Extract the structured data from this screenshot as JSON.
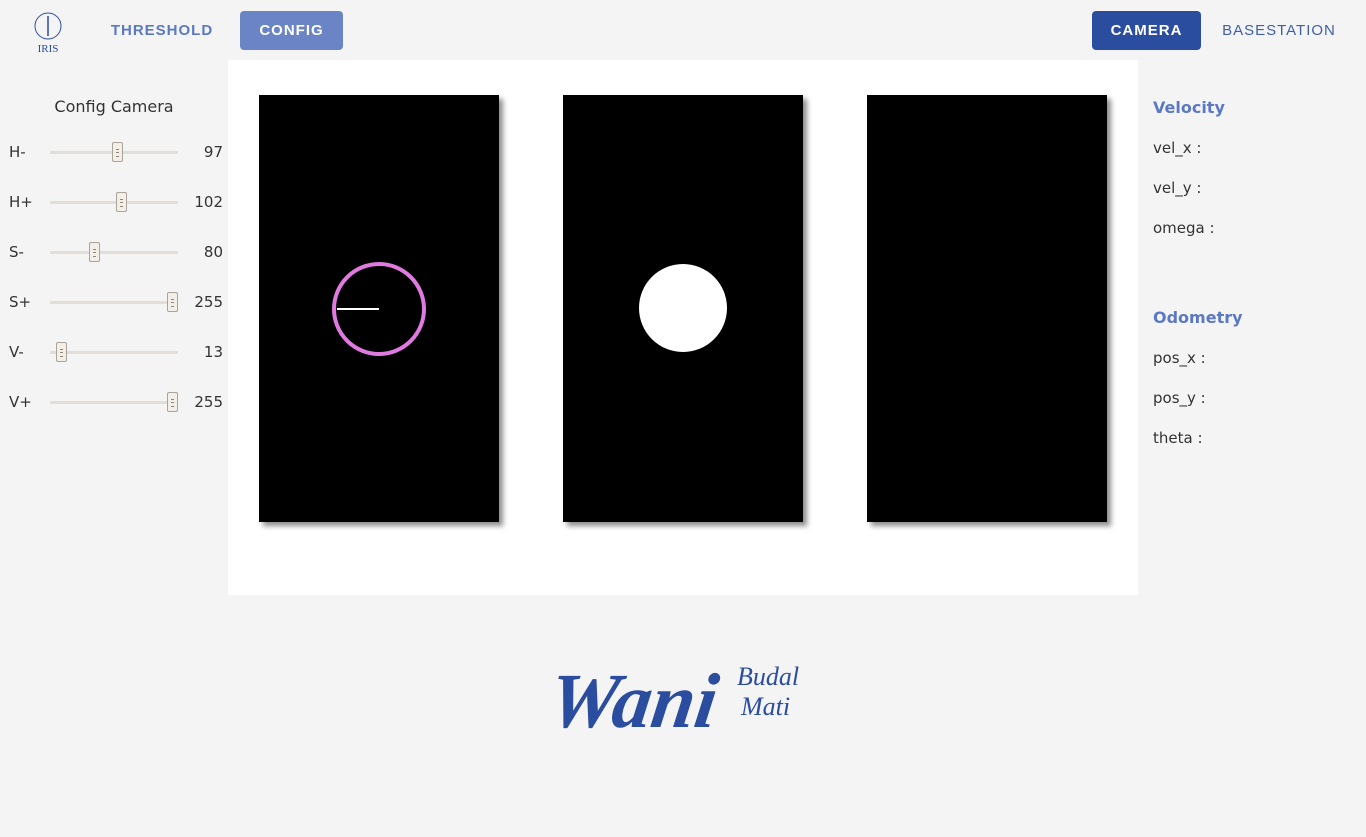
{
  "logo": {
    "text": "IRIS",
    "icon": "iris-logo-icon"
  },
  "nav": {
    "threshold": "THRESHOLD",
    "config": "CONFIG",
    "camera": "CAMERA",
    "basestation": "BASESTATION"
  },
  "config_camera": {
    "title": "Config Camera",
    "sliders": [
      {
        "label": "H-",
        "value": "97",
        "level": 0.53
      },
      {
        "label": "H+",
        "value": "102",
        "level": 0.56
      },
      {
        "label": "S-",
        "value": "80",
        "level": 0.33
      },
      {
        "label": "S+",
        "value": "255",
        "level": 1.0
      },
      {
        "label": "V-",
        "value": "13",
        "level": 0.05
      },
      {
        "label": "V+",
        "value": "255",
        "level": 1.0
      }
    ]
  },
  "velocity": {
    "heading": "Velocity",
    "items": [
      "vel_x :",
      "vel_y :",
      "omega :"
    ]
  },
  "odometry": {
    "heading": "Odometry",
    "items": [
      "pos_x :",
      "pos_y :",
      "theta :"
    ]
  },
  "brand": {
    "main": "Wani",
    "sub1": "Budal",
    "sub2": "Mati"
  },
  "colors": {
    "accent": "#5b79c2",
    "accent_dark": "#2b4da0",
    "detection_circle": "#e07ae0"
  }
}
